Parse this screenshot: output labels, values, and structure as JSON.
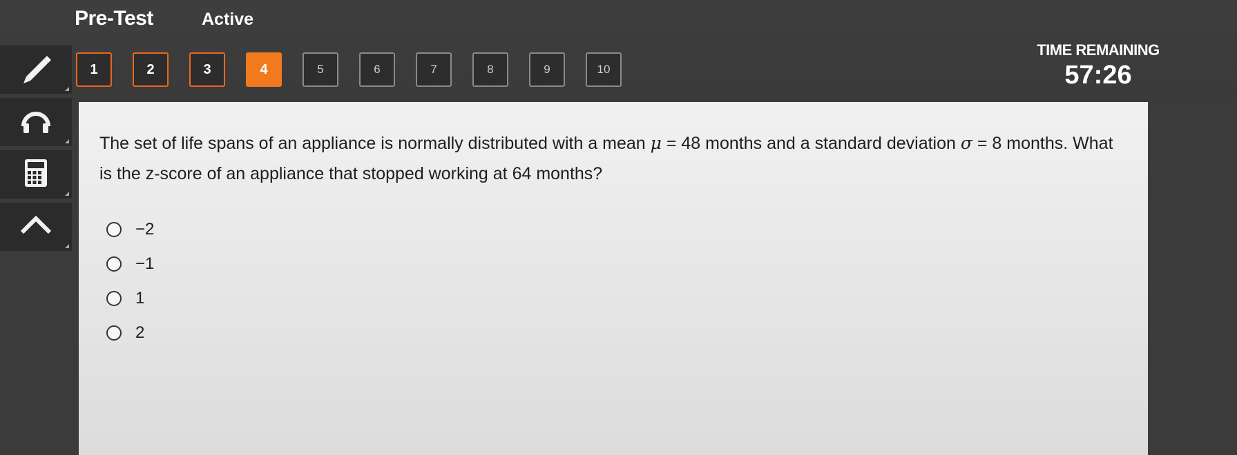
{
  "header": {
    "title": "Pre-Test",
    "status": "Active"
  },
  "question_nav": {
    "items": [
      {
        "label": "1",
        "state": "answered"
      },
      {
        "label": "2",
        "state": "answered"
      },
      {
        "label": "3",
        "state": "answered"
      },
      {
        "label": "4",
        "state": "current"
      },
      {
        "label": "5",
        "state": "unvisited"
      },
      {
        "label": "6",
        "state": "unvisited"
      },
      {
        "label": "7",
        "state": "unvisited"
      },
      {
        "label": "8",
        "state": "unvisited"
      },
      {
        "label": "9",
        "state": "unvisited"
      },
      {
        "label": "10",
        "state": "unvisited"
      }
    ]
  },
  "timer": {
    "label": "TIME REMAINING",
    "value": "57:26"
  },
  "tools": [
    "pencil-icon",
    "headphones-icon",
    "calculator-icon",
    "arrow-up-icon"
  ],
  "question": {
    "part1": "The set of life spans of an appliance is normally distributed with a mean",
    "mu_symbol": "μ",
    "part2": "= 48 months and a standard deviation",
    "sigma_symbol": "σ",
    "part3": "= 8 months. What is the z-score of an appliance that stopped working at 64 months?"
  },
  "choices": [
    {
      "label": "−2"
    },
    {
      "label": "−1"
    },
    {
      "label": "1"
    },
    {
      "label": "2"
    }
  ],
  "colors": {
    "accent": "#f07a1d",
    "background": "#3b3b3b",
    "panel": "#ececec"
  }
}
